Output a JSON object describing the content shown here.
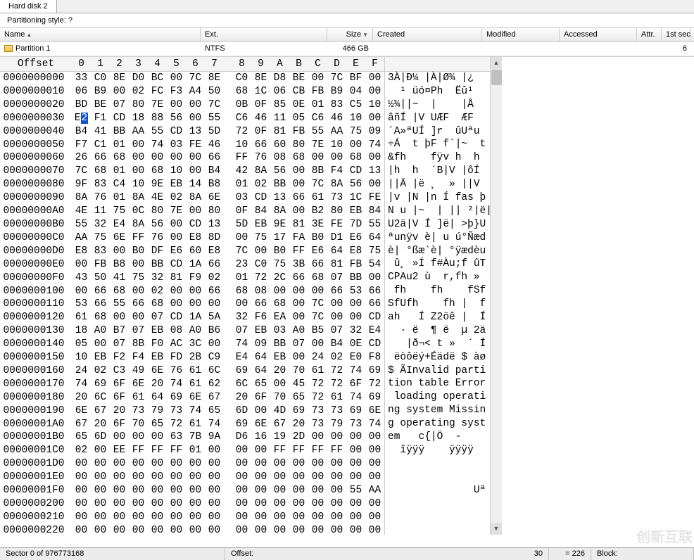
{
  "window": {
    "title": "Hard disk 2"
  },
  "partition_style_label": "Partitioning style: ?",
  "columns": {
    "name": "Name",
    "ext": "Ext.",
    "size": "Size",
    "created": "Created",
    "modified": "Modified",
    "accessed": "Accessed",
    "attr": "Attr.",
    "first": "1st sec"
  },
  "partition_row": {
    "name": "Partition 1",
    "ext": "NTFS",
    "size": "466 GB",
    "first": "6"
  },
  "offset_header": "Offset",
  "hex_cols": [
    "0",
    "1",
    "2",
    "3",
    "4",
    "5",
    "6",
    "7",
    "8",
    "9",
    "A",
    "B",
    "C",
    "D",
    "E",
    "F"
  ],
  "rows": [
    {
      "o": "0000000000",
      "h": [
        "33",
        "C0",
        "8E",
        "D0",
        "BC",
        "00",
        "7C",
        "8E",
        "C0",
        "8E",
        "D8",
        "BE",
        "00",
        "7C",
        "BF",
        "00"
      ],
      "a": "3À|Đ¼ |À|Ø¾ |¿"
    },
    {
      "o": "0000000010",
      "h": [
        "06",
        "B9",
        "00",
        "02",
        "FC",
        "F3",
        "A4",
        "50",
        "68",
        "1C",
        "06",
        "CB",
        "FB",
        "B9",
        "04",
        "00"
      ],
      "a": "  ¹ üó¤Ph  Ëû¹ "
    },
    {
      "o": "0000000020",
      "h": [
        "BD",
        "BE",
        "07",
        "80",
        "7E",
        "00",
        "00",
        "7C",
        "0B",
        "0F",
        "85",
        "0E",
        "01",
        "83",
        "C5",
        "10"
      ],
      "a": "½¾||~  |    |Å"
    },
    {
      "o": "0000000030",
      "h": [
        "E2",
        "F1",
        "CD",
        "18",
        "88",
        "56",
        "00",
        "55",
        "C6",
        "46",
        "11",
        "05",
        "C6",
        "46",
        "10",
        "00"
      ],
      "a": "âñÍ |V UÆF  ÆF"
    },
    {
      "o": "0000000040",
      "h": [
        "B4",
        "41",
        "BB",
        "AA",
        "55",
        "CD",
        "13",
        "5D",
        "72",
        "0F",
        "81",
        "FB",
        "55",
        "AA",
        "75",
        "09"
      ],
      "a": "´A»ªUÍ ]r  ûUªu"
    },
    {
      "o": "0000000050",
      "h": [
        "F7",
        "C1",
        "01",
        "00",
        "74",
        "03",
        "FE",
        "46",
        "10",
        "66",
        "60",
        "80",
        "7E",
        "10",
        "00",
        "74"
      ],
      "a": "÷Á  t þF f`|~  t"
    },
    {
      "o": "0000000060",
      "h": [
        "26",
        "66",
        "68",
        "00",
        "00",
        "00",
        "00",
        "66",
        "FF",
        "76",
        "08",
        "68",
        "00",
        "00",
        "68",
        "00"
      ],
      "a": "&fh    fÿv h  h"
    },
    {
      "o": "0000000070",
      "h": [
        "7C",
        "68",
        "01",
        "00",
        "68",
        "10",
        "00",
        "B4",
        "42",
        "8A",
        "56",
        "00",
        "8B",
        "F4",
        "CD",
        "13"
      ],
      "a": "|h  h  ´B|V |ôÍ"
    },
    {
      "o": "0000000080",
      "h": [
        "9F",
        "83",
        "C4",
        "10",
        "9E",
        "EB",
        "14",
        "B8",
        "01",
        "02",
        "BB",
        "00",
        "7C",
        "8A",
        "56",
        "00"
      ],
      "a": "||Ä |ë ¸  » ||V"
    },
    {
      "o": "0000000090",
      "h": [
        "8A",
        "76",
        "01",
        "8A",
        "4E",
        "02",
        "8A",
        "6E",
        "03",
        "CD",
        "13",
        "66",
        "61",
        "73",
        "1C",
        "FE"
      ],
      "a": "|v |N |n Í fas þ"
    },
    {
      "o": "00000000A0",
      "h": [
        "4E",
        "11",
        "75",
        "0C",
        "80",
        "7E",
        "00",
        "80",
        "0F",
        "84",
        "8A",
        "00",
        "B2",
        "80",
        "EB",
        "84"
      ],
      "a": "N u |~  | || ²|ë|"
    },
    {
      "o": "00000000B0",
      "h": [
        "55",
        "32",
        "E4",
        "8A",
        "56",
        "00",
        "CD",
        "13",
        "5D",
        "EB",
        "9E",
        "81",
        "3E",
        "FE",
        "7D",
        "55"
      ],
      "a": "U2ä|V Í ]ë| >þ}U"
    },
    {
      "o": "00000000C0",
      "h": [
        "AA",
        "75",
        "6E",
        "FF",
        "76",
        "00",
        "E8",
        "8D",
        "00",
        "75",
        "17",
        "FA",
        "B0",
        "D1",
        "E6",
        "64"
      ],
      "a": "ªunÿv è| u ú°Ñæd"
    },
    {
      "o": "00000000D0",
      "h": [
        "E8",
        "83",
        "00",
        "B0",
        "DF",
        "E6",
        "60",
        "E8",
        "7C",
        "00",
        "B0",
        "FF",
        "E6",
        "64",
        "E8",
        "75"
      ],
      "a": "è| °ßæ`è| °ÿædèu"
    },
    {
      "o": "00000000E0",
      "h": [
        "00",
        "FB",
        "B8",
        "00",
        "BB",
        "CD",
        "1A",
        "66",
        "23",
        "C0",
        "75",
        "3B",
        "66",
        "81",
        "FB",
        "54"
      ],
      "a": " û¸ »Í f#Àu;f ûT"
    },
    {
      "o": "00000000F0",
      "h": [
        "43",
        "50",
        "41",
        "75",
        "32",
        "81",
        "F9",
        "02",
        "01",
        "72",
        "2C",
        "66",
        "68",
        "07",
        "BB",
        "00"
      ],
      "a": "CPAu2 ù  r,fh »"
    },
    {
      "o": "0000000100",
      "h": [
        "00",
        "66",
        "68",
        "00",
        "02",
        "00",
        "00",
        "66",
        "68",
        "08",
        "00",
        "00",
        "00",
        "66",
        "53",
        "66"
      ],
      "a": " fh    fh    fSf"
    },
    {
      "o": "0000000110",
      "h": [
        "53",
        "66",
        "55",
        "66",
        "68",
        "00",
        "00",
        "00",
        "00",
        "66",
        "68",
        "00",
        "7C",
        "00",
        "00",
        "66"
      ],
      "a": "SfUfh    fh |  f"
    },
    {
      "o": "0000000120",
      "h": [
        "61",
        "68",
        "00",
        "00",
        "07",
        "CD",
        "1A",
        "5A",
        "32",
        "F6",
        "EA",
        "00",
        "7C",
        "00",
        "00",
        "CD"
      ],
      "a": "ah   Í Z2öê |  Í"
    },
    {
      "o": "0000000130",
      "h": [
        "18",
        "A0",
        "B7",
        "07",
        "EB",
        "08",
        "A0",
        "B6",
        "07",
        "EB",
        "03",
        "A0",
        "B5",
        "07",
        "32",
        "E4"
      ],
      "a": "  · ë  ¶ ë  µ 2ä"
    },
    {
      "o": "0000000140",
      "h": [
        "05",
        "00",
        "07",
        "8B",
        "F0",
        "AC",
        "3C",
        "00",
        "74",
        "09",
        "BB",
        "07",
        "00",
        "B4",
        "0E",
        "CD"
      ],
      "a": "   |ð¬< t »  ´ Í"
    },
    {
      "o": "0000000150",
      "h": [
        "10",
        "EB",
        "F2",
        "F4",
        "EB",
        "FD",
        "2B",
        "C9",
        "E4",
        "64",
        "EB",
        "00",
        "24",
        "02",
        "E0",
        "F8"
      ],
      "a": " ëòôëý+Éädë $ àø"
    },
    {
      "o": "0000000160",
      "h": [
        "24",
        "02",
        "C3",
        "49",
        "6E",
        "76",
        "61",
        "6C",
        "69",
        "64",
        "20",
        "70",
        "61",
        "72",
        "74",
        "69"
      ],
      "a": "$ ÃInvalid parti"
    },
    {
      "o": "0000000170",
      "h": [
        "74",
        "69",
        "6F",
        "6E",
        "20",
        "74",
        "61",
        "62",
        "6C",
        "65",
        "00",
        "45",
        "72",
        "72",
        "6F",
        "72"
      ],
      "a": "tion table Error"
    },
    {
      "o": "0000000180",
      "h": [
        "20",
        "6C",
        "6F",
        "61",
        "64",
        "69",
        "6E",
        "67",
        "20",
        "6F",
        "70",
        "65",
        "72",
        "61",
        "74",
        "69"
      ],
      "a": " loading operati"
    },
    {
      "o": "0000000190",
      "h": [
        "6E",
        "67",
        "20",
        "73",
        "79",
        "73",
        "74",
        "65",
        "6D",
        "00",
        "4D",
        "69",
        "73",
        "73",
        "69",
        "6E"
      ],
      "a": "ng system Missin"
    },
    {
      "o": "00000001A0",
      "h": [
        "67",
        "20",
        "6F",
        "70",
        "65",
        "72",
        "61",
        "74",
        "69",
        "6E",
        "67",
        "20",
        "73",
        "79",
        "73",
        "74"
      ],
      "a": "g operating syst"
    },
    {
      "o": "00000001B0",
      "h": [
        "65",
        "6D",
        "00",
        "00",
        "00",
        "63",
        "7B",
        "9A",
        "D6",
        "16",
        "19",
        "2D",
        "00",
        "00",
        "00",
        "00"
      ],
      "a": "em   c{|Ö  -"
    },
    {
      "o": "00000001C0",
      "h": [
        "02",
        "00",
        "EE",
        "FF",
        "FF",
        "FF",
        "01",
        "00",
        "00",
        "00",
        "FF",
        "FF",
        "FF",
        "FF",
        "00",
        "00"
      ],
      "a": "  îÿÿÿ    ÿÿÿÿ"
    },
    {
      "o": "00000001D0",
      "h": [
        "00",
        "00",
        "00",
        "00",
        "00",
        "00",
        "00",
        "00",
        "00",
        "00",
        "00",
        "00",
        "00",
        "00",
        "00",
        "00"
      ],
      "a": ""
    },
    {
      "o": "00000001E0",
      "h": [
        "00",
        "00",
        "00",
        "00",
        "00",
        "00",
        "00",
        "00",
        "00",
        "00",
        "00",
        "00",
        "00",
        "00",
        "00",
        "00"
      ],
      "a": ""
    },
    {
      "o": "00000001F0",
      "h": [
        "00",
        "00",
        "00",
        "00",
        "00",
        "00",
        "00",
        "00",
        "00",
        "00",
        "00",
        "00",
        "00",
        "00",
        "55",
        "AA"
      ],
      "a": "              Uª"
    },
    {
      "o": "0000000200",
      "h": [
        "00",
        "00",
        "00",
        "00",
        "00",
        "00",
        "00",
        "00",
        "00",
        "00",
        "00",
        "00",
        "00",
        "00",
        "00",
        "00"
      ],
      "a": ""
    },
    {
      "o": "0000000210",
      "h": [
        "00",
        "00",
        "00",
        "00",
        "00",
        "00",
        "00",
        "00",
        "00",
        "00",
        "00",
        "00",
        "00",
        "00",
        "00",
        "00"
      ],
      "a": ""
    },
    {
      "o": "0000000220",
      "h": [
        "00",
        "00",
        "00",
        "00",
        "00",
        "00",
        "00",
        "00",
        "00",
        "00",
        "00",
        "00",
        "00",
        "00",
        "00",
        "00"
      ],
      "a": ""
    }
  ],
  "cursor": {
    "row": 3,
    "col": 0,
    "char": 1
  },
  "status": {
    "sector": "Sector 0 of 976773168",
    "offset_label": "Offset:",
    "offset_value": "30",
    "value_eq": "= 226",
    "block": "Block:"
  },
  "watermark": "创新互联"
}
